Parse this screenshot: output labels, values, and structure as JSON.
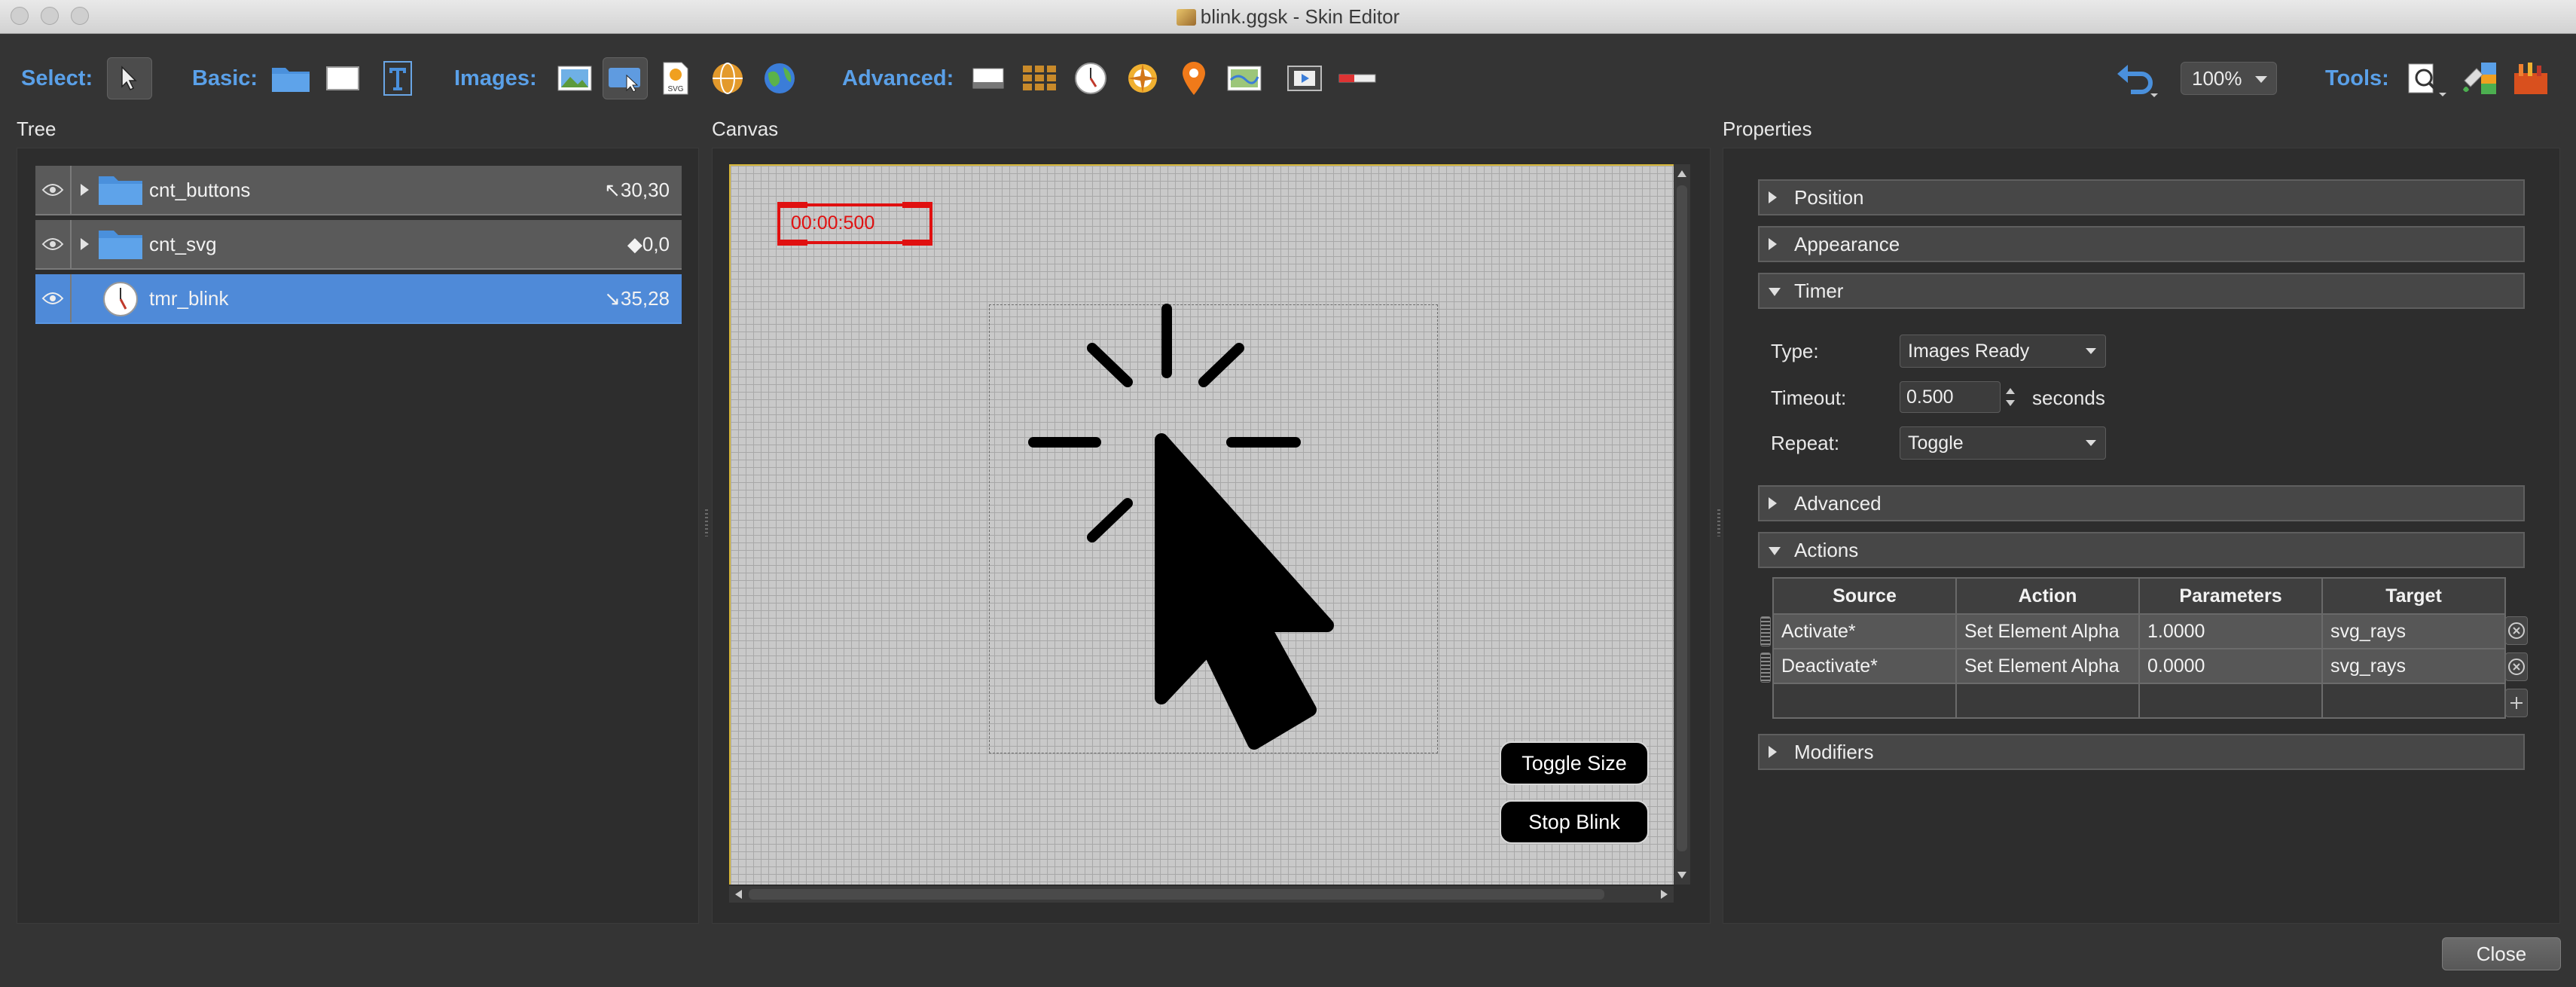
{
  "window": {
    "title": "blink.ggsk - Skin Editor"
  },
  "toolbar": {
    "select_label": "Select:",
    "basic_label": "Basic:",
    "images_label": "Images:",
    "advanced_label": "Advanced:",
    "tools_label": "Tools:",
    "zoom": "100%"
  },
  "tree": {
    "title": "Tree",
    "rows": [
      {
        "name": "cnt_buttons",
        "value": "↖30,30"
      },
      {
        "name": "cnt_svg",
        "value": "◆0,0"
      },
      {
        "name": "tmr_blink",
        "value": "↘35,28"
      }
    ]
  },
  "canvas": {
    "title": "Canvas",
    "timer_text": "00:00:500",
    "toggle_size_label": "Toggle Size",
    "stop_blink_label": "Stop Blink"
  },
  "properties": {
    "title": "Properties",
    "sections": {
      "position": "Position",
      "appearance": "Appearance",
      "timer": "Timer",
      "advanced": "Advanced",
      "actions": "Actions",
      "modifiers": "Modifiers"
    },
    "timer": {
      "type_label": "Type:",
      "type_value": "Images Ready",
      "timeout_label": "Timeout:",
      "timeout_value": "0.500",
      "timeout_unit": "seconds",
      "repeat_label": "Repeat:",
      "repeat_value": "Toggle"
    },
    "actions": {
      "headers": [
        "Source",
        "Action",
        "Parameters",
        "Target"
      ],
      "rows": [
        [
          "Activate*",
          "Set Element Alpha",
          "1.0000",
          "svg_rays"
        ],
        [
          "Deactivate*",
          "Set Element Alpha",
          "0.0000",
          "svg_rays"
        ]
      ]
    }
  },
  "footer": {
    "close_label": "Close"
  },
  "colors": {
    "accent": "#5aa0e8",
    "selection": "#4f8ad8",
    "timer_red": "#e01010"
  }
}
